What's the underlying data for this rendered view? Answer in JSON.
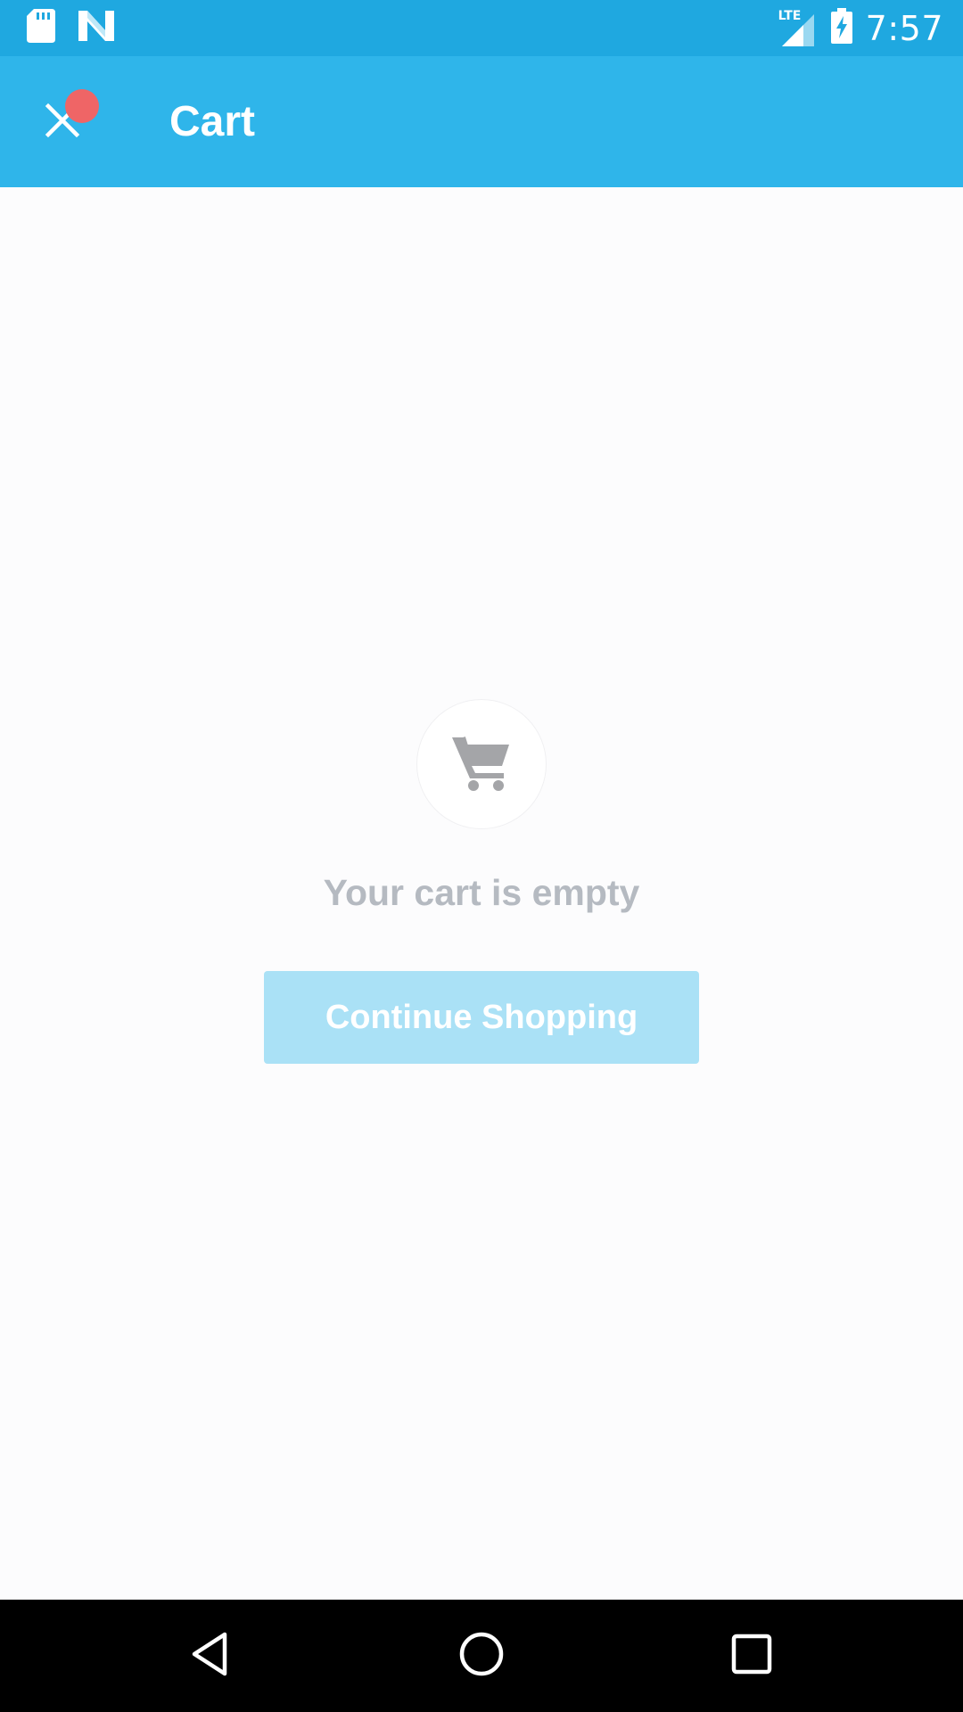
{
  "status_bar": {
    "time": "7:57",
    "network_label": "LTE",
    "icons": [
      "sd-card-icon",
      "n-notification-icon",
      "signal-icon",
      "battery-charging-icon"
    ],
    "background": "#1fa8e0"
  },
  "app_bar": {
    "title": "Cart",
    "close_icon": "close-icon",
    "background": "#2fb5ea",
    "notification_dot_color": "#ef6566"
  },
  "empty_state": {
    "icon": "shopping-cart-icon",
    "message": "Your cart is empty",
    "button_label": "Continue Shopping",
    "button_color": "#aae1f6"
  },
  "nav_bar": {
    "items": [
      "back-icon",
      "home-icon",
      "recents-icon"
    ]
  }
}
